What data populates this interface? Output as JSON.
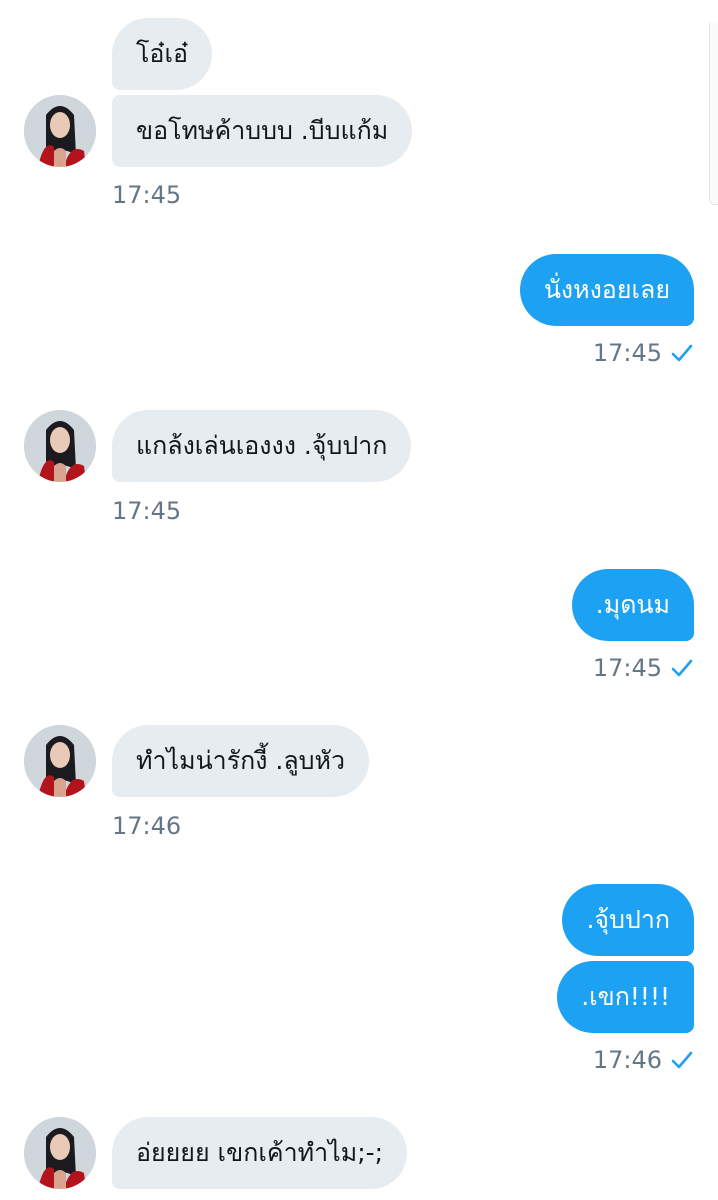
{
  "messages": [
    {
      "id": "m1",
      "from": "them",
      "text": "โอ๋เอ๋"
    },
    {
      "id": "m2",
      "from": "them",
      "text": "ขอโทษค้าบบบ .บีบแก้ม"
    },
    {
      "id": "t1",
      "time": "17:45"
    },
    {
      "id": "m3",
      "from": "me",
      "text": "นั่งหงอยเลย"
    },
    {
      "id": "t2",
      "time": "17:45"
    },
    {
      "id": "m4",
      "from": "them",
      "text": "แกล้งเล่นเองงง .จุ้บปาก"
    },
    {
      "id": "t3",
      "time": "17:45"
    },
    {
      "id": "m5",
      "from": "me",
      "text": ".มุดนม"
    },
    {
      "id": "t4",
      "time": "17:45"
    },
    {
      "id": "m6",
      "from": "them",
      "text": "ทำไมน่ารักงี้ .ลูบหัว"
    },
    {
      "id": "t5",
      "time": "17:46"
    },
    {
      "id": "m7",
      "from": "me",
      "text": ".จุ้บปาก"
    },
    {
      "id": "m8",
      "from": "me",
      "text": ".เขก!!!!"
    },
    {
      "id": "t6",
      "time": "17:46"
    },
    {
      "id": "m9",
      "from": "them",
      "text": "อ่ยยยย เขกเค้าทำไม;-;"
    }
  ],
  "icons": {
    "sent_status": "check-icon",
    "avatar": "contact-avatar"
  },
  "colors": {
    "outgoing": "#1da1f2",
    "incoming": "#e6ecf0",
    "timestamp": "#657786",
    "check": "#1da1f2"
  }
}
